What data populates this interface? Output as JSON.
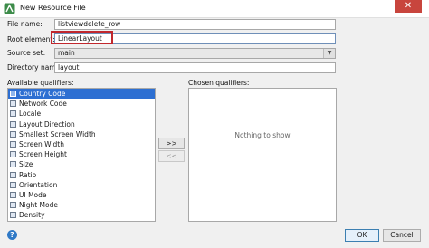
{
  "window": {
    "title": "New Resource File",
    "close_glyph": "✕"
  },
  "form": {
    "file_name_label": "File name:",
    "file_name_value": "listviewdelete_row",
    "root_element_label": "Root element:",
    "root_element_value": "LinearLayout",
    "source_set_label": "Source set:",
    "source_set_value": "main",
    "directory_name_label": "Directory name:",
    "directory_name_value": "layout"
  },
  "qualifiers": {
    "available_label": "Available qualifiers:",
    "chosen_label": "Chosen qualifiers:",
    "items": [
      {
        "label": "Country Code",
        "selected": true
      },
      {
        "label": "Network Code",
        "selected": false
      },
      {
        "label": "Locale",
        "selected": false
      },
      {
        "label": "Layout Direction",
        "selected": false
      },
      {
        "label": "Smallest Screen Width",
        "selected": false
      },
      {
        "label": "Screen Width",
        "selected": false
      },
      {
        "label": "Screen Height",
        "selected": false
      },
      {
        "label": "Size",
        "selected": false
      },
      {
        "label": "Ratio",
        "selected": false
      },
      {
        "label": "Orientation",
        "selected": false
      },
      {
        "label": "UI Mode",
        "selected": false
      },
      {
        "label": "Night Mode",
        "selected": false
      },
      {
        "label": "Density",
        "selected": false
      }
    ],
    "chosen_empty_text": "Nothing to show",
    "add_button": ">>",
    "remove_button": "<<"
  },
  "footer": {
    "help_glyph": "?",
    "ok_label": "OK",
    "cancel_label": "Cancel"
  },
  "colors": {
    "selection": "#2d6fd2",
    "annotation": "#c1272d",
    "close": "#c8453d"
  }
}
